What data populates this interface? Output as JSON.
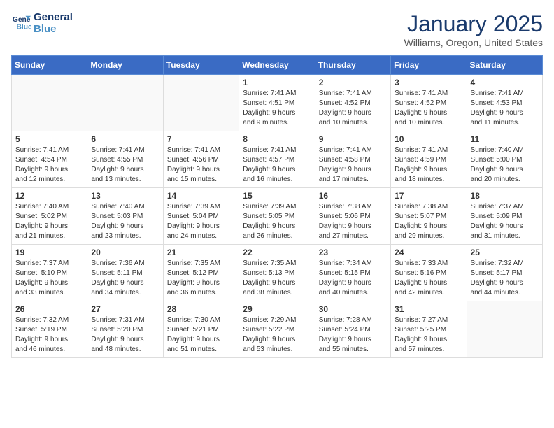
{
  "logo": {
    "line1": "General",
    "line2": "Blue"
  },
  "title": "January 2025",
  "location": "Williams, Oregon, United States",
  "days_header": [
    "Sunday",
    "Monday",
    "Tuesday",
    "Wednesday",
    "Thursday",
    "Friday",
    "Saturday"
  ],
  "weeks": [
    [
      {
        "day": "",
        "info": ""
      },
      {
        "day": "",
        "info": ""
      },
      {
        "day": "",
        "info": ""
      },
      {
        "day": "1",
        "info": "Sunrise: 7:41 AM\nSunset: 4:51 PM\nDaylight: 9 hours\nand 9 minutes."
      },
      {
        "day": "2",
        "info": "Sunrise: 7:41 AM\nSunset: 4:52 PM\nDaylight: 9 hours\nand 10 minutes."
      },
      {
        "day": "3",
        "info": "Sunrise: 7:41 AM\nSunset: 4:52 PM\nDaylight: 9 hours\nand 10 minutes."
      },
      {
        "day": "4",
        "info": "Sunrise: 7:41 AM\nSunset: 4:53 PM\nDaylight: 9 hours\nand 11 minutes."
      }
    ],
    [
      {
        "day": "5",
        "info": "Sunrise: 7:41 AM\nSunset: 4:54 PM\nDaylight: 9 hours\nand 12 minutes."
      },
      {
        "day": "6",
        "info": "Sunrise: 7:41 AM\nSunset: 4:55 PM\nDaylight: 9 hours\nand 13 minutes."
      },
      {
        "day": "7",
        "info": "Sunrise: 7:41 AM\nSunset: 4:56 PM\nDaylight: 9 hours\nand 15 minutes."
      },
      {
        "day": "8",
        "info": "Sunrise: 7:41 AM\nSunset: 4:57 PM\nDaylight: 9 hours\nand 16 minutes."
      },
      {
        "day": "9",
        "info": "Sunrise: 7:41 AM\nSunset: 4:58 PM\nDaylight: 9 hours\nand 17 minutes."
      },
      {
        "day": "10",
        "info": "Sunrise: 7:41 AM\nSunset: 4:59 PM\nDaylight: 9 hours\nand 18 minutes."
      },
      {
        "day": "11",
        "info": "Sunrise: 7:40 AM\nSunset: 5:00 PM\nDaylight: 9 hours\nand 20 minutes."
      }
    ],
    [
      {
        "day": "12",
        "info": "Sunrise: 7:40 AM\nSunset: 5:02 PM\nDaylight: 9 hours\nand 21 minutes."
      },
      {
        "day": "13",
        "info": "Sunrise: 7:40 AM\nSunset: 5:03 PM\nDaylight: 9 hours\nand 23 minutes."
      },
      {
        "day": "14",
        "info": "Sunrise: 7:39 AM\nSunset: 5:04 PM\nDaylight: 9 hours\nand 24 minutes."
      },
      {
        "day": "15",
        "info": "Sunrise: 7:39 AM\nSunset: 5:05 PM\nDaylight: 9 hours\nand 26 minutes."
      },
      {
        "day": "16",
        "info": "Sunrise: 7:38 AM\nSunset: 5:06 PM\nDaylight: 9 hours\nand 27 minutes."
      },
      {
        "day": "17",
        "info": "Sunrise: 7:38 AM\nSunset: 5:07 PM\nDaylight: 9 hours\nand 29 minutes."
      },
      {
        "day": "18",
        "info": "Sunrise: 7:37 AM\nSunset: 5:09 PM\nDaylight: 9 hours\nand 31 minutes."
      }
    ],
    [
      {
        "day": "19",
        "info": "Sunrise: 7:37 AM\nSunset: 5:10 PM\nDaylight: 9 hours\nand 33 minutes."
      },
      {
        "day": "20",
        "info": "Sunrise: 7:36 AM\nSunset: 5:11 PM\nDaylight: 9 hours\nand 34 minutes."
      },
      {
        "day": "21",
        "info": "Sunrise: 7:35 AM\nSunset: 5:12 PM\nDaylight: 9 hours\nand 36 minutes."
      },
      {
        "day": "22",
        "info": "Sunrise: 7:35 AM\nSunset: 5:13 PM\nDaylight: 9 hours\nand 38 minutes."
      },
      {
        "day": "23",
        "info": "Sunrise: 7:34 AM\nSunset: 5:15 PM\nDaylight: 9 hours\nand 40 minutes."
      },
      {
        "day": "24",
        "info": "Sunrise: 7:33 AM\nSunset: 5:16 PM\nDaylight: 9 hours\nand 42 minutes."
      },
      {
        "day": "25",
        "info": "Sunrise: 7:32 AM\nSunset: 5:17 PM\nDaylight: 9 hours\nand 44 minutes."
      }
    ],
    [
      {
        "day": "26",
        "info": "Sunrise: 7:32 AM\nSunset: 5:19 PM\nDaylight: 9 hours\nand 46 minutes."
      },
      {
        "day": "27",
        "info": "Sunrise: 7:31 AM\nSunset: 5:20 PM\nDaylight: 9 hours\nand 48 minutes."
      },
      {
        "day": "28",
        "info": "Sunrise: 7:30 AM\nSunset: 5:21 PM\nDaylight: 9 hours\nand 51 minutes."
      },
      {
        "day": "29",
        "info": "Sunrise: 7:29 AM\nSunset: 5:22 PM\nDaylight: 9 hours\nand 53 minutes."
      },
      {
        "day": "30",
        "info": "Sunrise: 7:28 AM\nSunset: 5:24 PM\nDaylight: 9 hours\nand 55 minutes."
      },
      {
        "day": "31",
        "info": "Sunrise: 7:27 AM\nSunset: 5:25 PM\nDaylight: 9 hours\nand 57 minutes."
      },
      {
        "day": "",
        "info": ""
      }
    ]
  ]
}
